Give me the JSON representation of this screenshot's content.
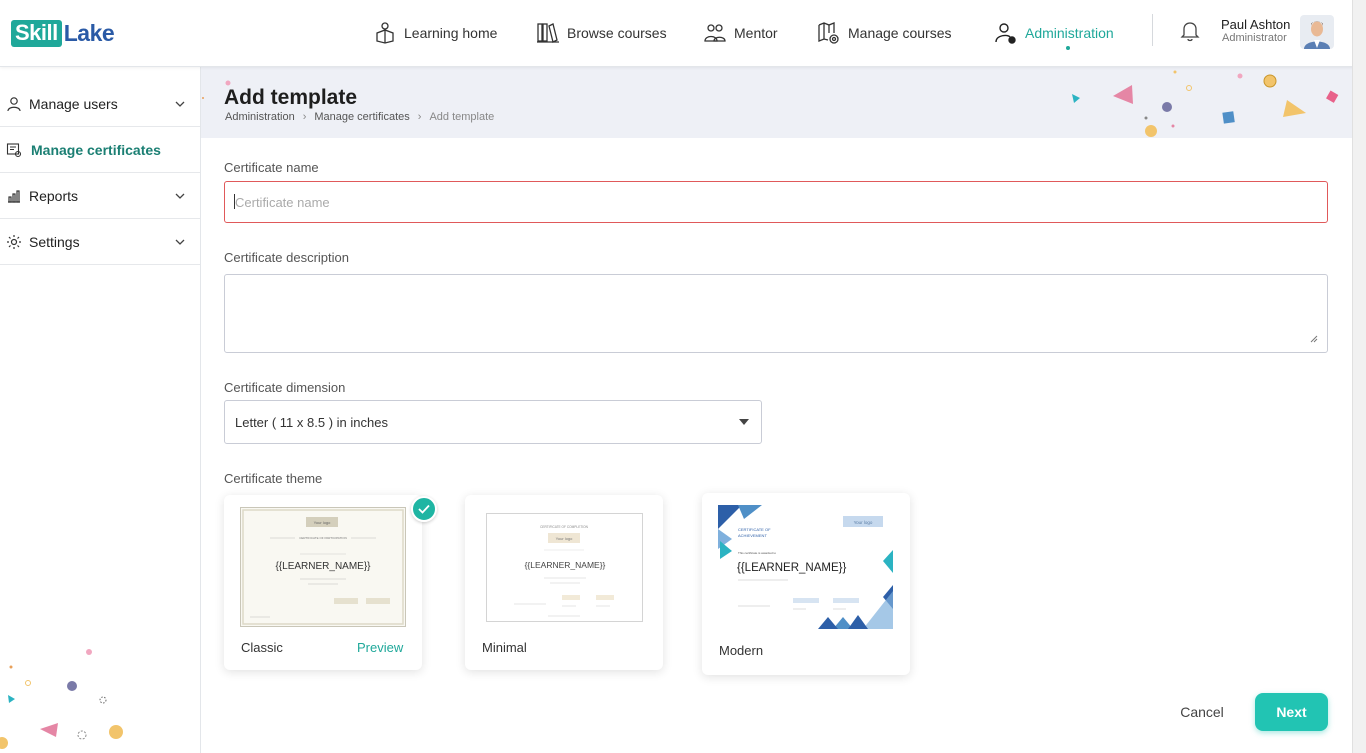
{
  "app": {
    "logo_part1": "Skill",
    "logo_part2": "Lake"
  },
  "nav": {
    "items": [
      {
        "label": "Learning home",
        "icon": "learning-home-icon"
      },
      {
        "label": "Browse courses",
        "icon": "browse-courses-icon"
      },
      {
        "label": "Mentor",
        "icon": "mentor-icon"
      },
      {
        "label": "Manage courses",
        "icon": "manage-courses-icon"
      },
      {
        "label": "Administration",
        "icon": "administration-icon",
        "active": true
      }
    ]
  },
  "user": {
    "name": "Paul Ashton",
    "role": "Administrator"
  },
  "sidebar": {
    "items": [
      {
        "label": "Manage users",
        "icon": "user-icon",
        "expandable": true
      },
      {
        "label": "Manage certificates",
        "icon": "certificate-icon",
        "active": true
      },
      {
        "label": "Reports",
        "icon": "reports-icon",
        "expandable": true
      },
      {
        "label": "Settings",
        "icon": "gear-icon",
        "expandable": true
      }
    ]
  },
  "header": {
    "title": "Add template",
    "breadcrumb": [
      "Administration",
      "Manage certificates",
      "Add template"
    ]
  },
  "form": {
    "name_label": "Certificate name",
    "name_placeholder": "Certificate name",
    "name_value": "",
    "description_label": "Certificate description",
    "description_value": "",
    "dimension_label": "Certificate dimension",
    "dimension_value": "Letter ( 11 x 8.5 ) in inches",
    "theme_label": "Certificate theme"
  },
  "themes": [
    {
      "name": "Classic",
      "selected": true,
      "preview_label": "Preview",
      "thumb": {
        "logo": "Your logo",
        "heading": "CERTIFICATE OF PARTICIPATION",
        "learner": "{{LEARNER_NAME}}"
      }
    },
    {
      "name": "Minimal",
      "selected": false,
      "thumb": {
        "logo": "Your logo",
        "heading": "CERTIFICATE OF COMPLETION",
        "learner": "{{LEARNER_NAME}}"
      }
    },
    {
      "name": "Modern",
      "selected": false,
      "thumb": {
        "logo": "Your logo",
        "heading1": "CERTIFICATE OF",
        "heading2": "ACHIEVEMENT",
        "intro": "This certificate is awarded to",
        "learner": "{{LEARNER_NAME}}"
      }
    }
  ],
  "actions": {
    "cancel": "Cancel",
    "next": "Next"
  },
  "colors": {
    "accent": "#1fa89a",
    "next_button": "#22c4b3",
    "error_border": "#e0595a",
    "header_band": "#eef0f6",
    "logo_blue": "#2a5aa6"
  }
}
